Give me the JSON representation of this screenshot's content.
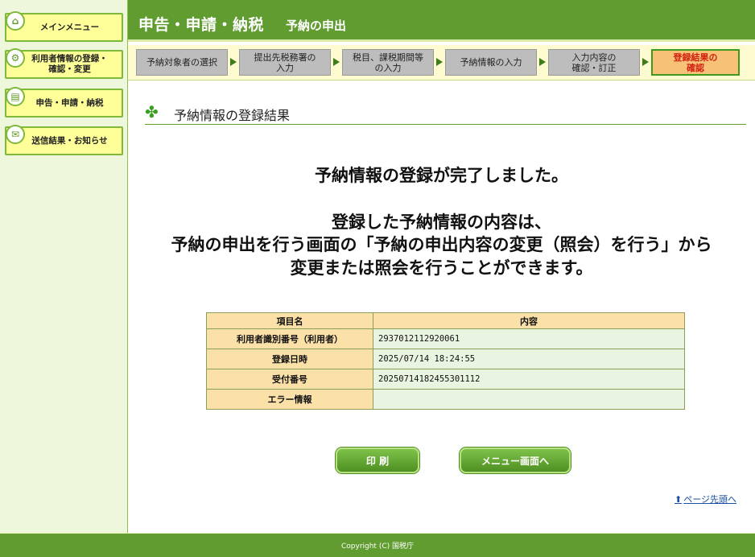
{
  "sidebar": {
    "items": [
      {
        "label": "メインメニュー",
        "icon": "home-icon"
      },
      {
        "label": "利用者情報の登録・確認・変更",
        "line1": "利用者情報の登録・",
        "line2": "確認・変更",
        "icon": "settings-icon"
      },
      {
        "label": "申告・申請・納税",
        "icon": "document-icon"
      },
      {
        "label": "送信結果・お知らせ",
        "icon": "mail-icon"
      }
    ]
  },
  "header": {
    "title": "申告・申請・納税",
    "subtitle": "予納の申出"
  },
  "steps": [
    {
      "line1": "予納対象者の選択",
      "line2": ""
    },
    {
      "line1": "提出先税務署の",
      "line2": "入力"
    },
    {
      "line1": "税目、課税期間等",
      "line2": "の入力"
    },
    {
      "line1": "予納情報の入力",
      "line2": ""
    },
    {
      "line1": "入力内容の",
      "line2": "確認・訂正"
    },
    {
      "line1": "登録結果の",
      "line2": "確認",
      "active": true
    }
  ],
  "section": {
    "title": "予納情報の登録結果"
  },
  "messages": {
    "complete": "予納情報の登録が完了しました。",
    "line1": "登録した予納情報の内容は、",
    "line2": "予納の申出を行う画面の「予納の申出内容の変更（照会）を行う」から",
    "line3": "変更または照会を行うことができます。"
  },
  "table": {
    "headers": [
      "項目名",
      "内容"
    ],
    "rows": [
      {
        "label": "利用者識別番号（利用者）",
        "value": "2937012112920061"
      },
      {
        "label": "登録日時",
        "value": "2025/07/14 18:24:55"
      },
      {
        "label": "受付番号",
        "value": "20250714182455301112"
      },
      {
        "label": "エラー情報",
        "value": ""
      }
    ]
  },
  "buttons": {
    "print": "印 刷",
    "menu": "メニュー画面へ"
  },
  "page_top": "ページ先頭へ",
  "footer": "Copyright (C) 国税庁",
  "colors": {
    "header_green": "#609c30",
    "active_step": "#f7c277",
    "sidebar_button": "#ffff99"
  }
}
